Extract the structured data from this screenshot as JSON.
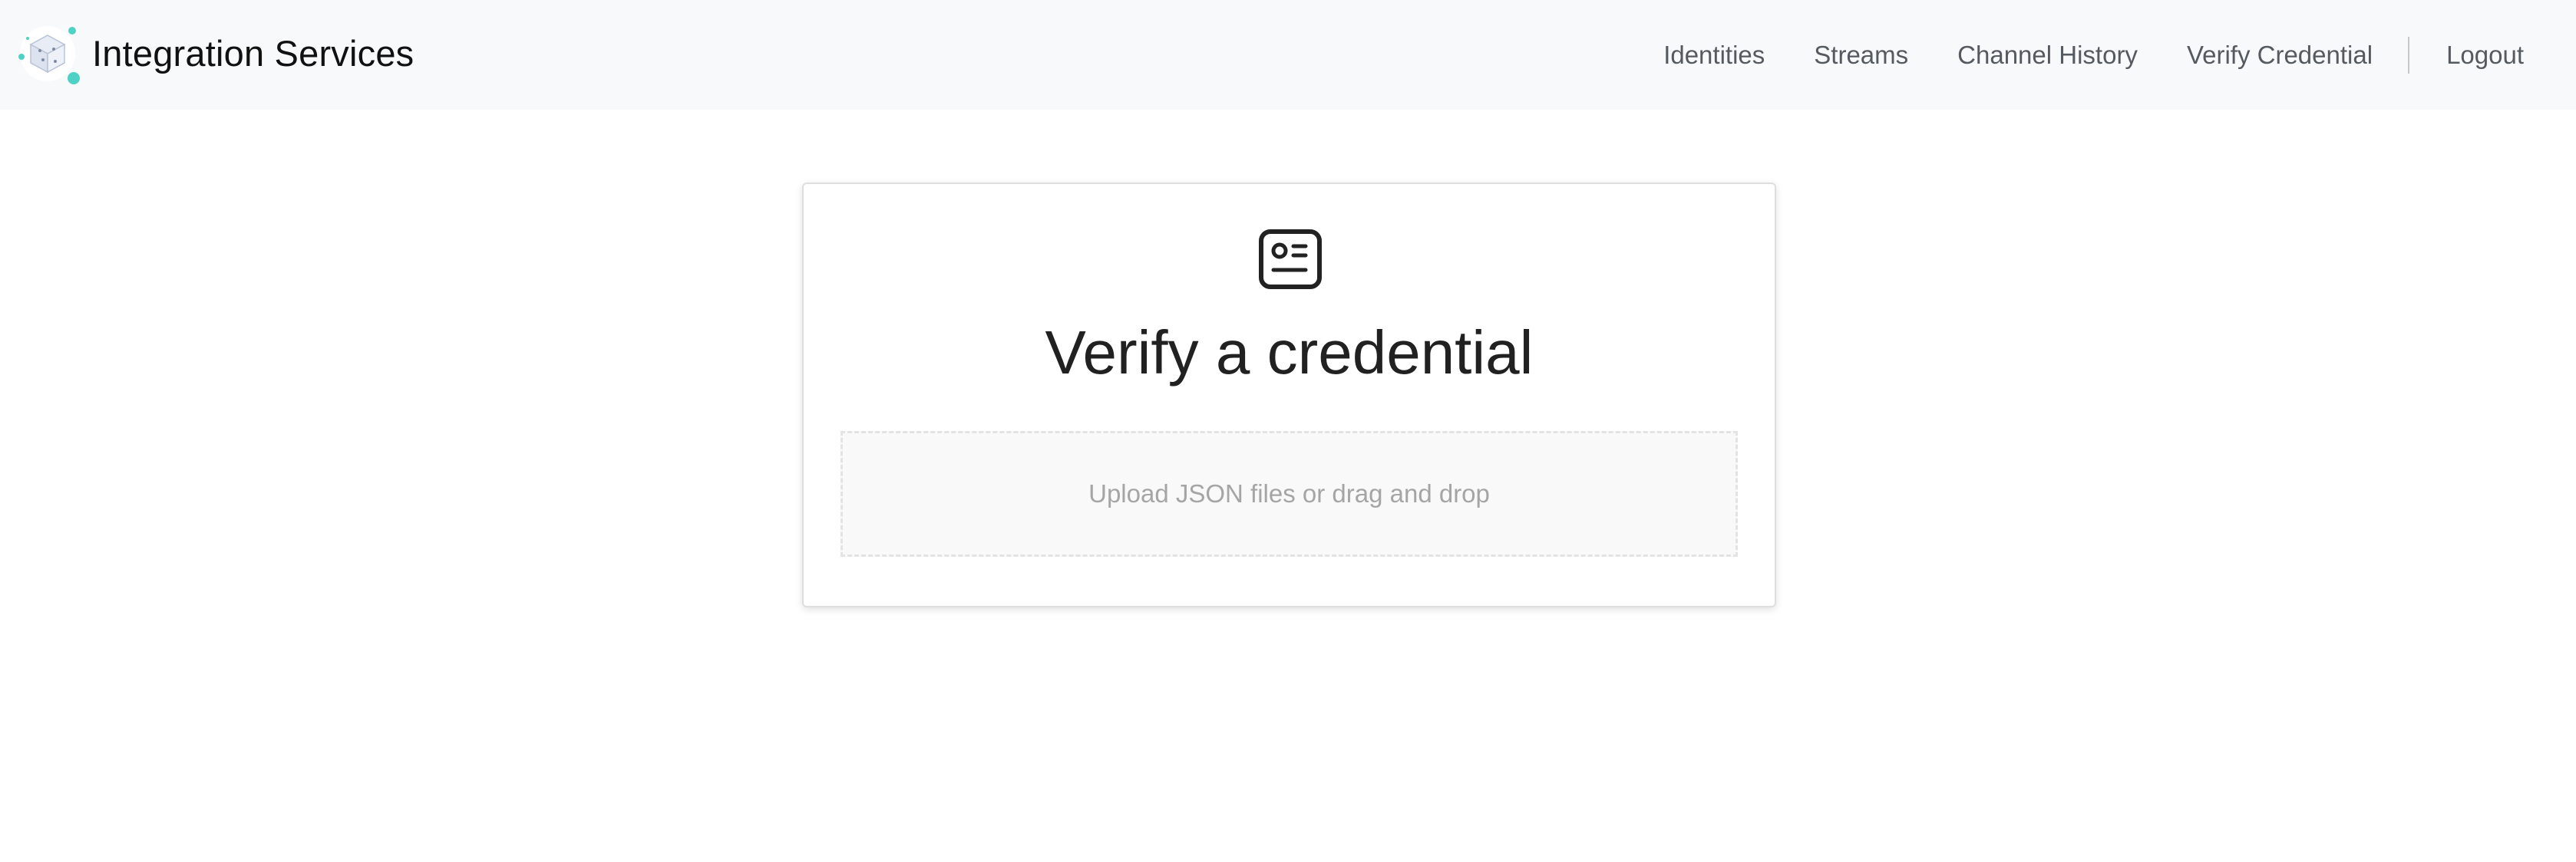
{
  "brand": {
    "name": "Integration Services",
    "logo_icon": "iota-cube-logo",
    "accent_color": "#4fd1c5"
  },
  "nav": {
    "items": [
      {
        "label": "Identities"
      },
      {
        "label": "Streams"
      },
      {
        "label": "Channel History"
      },
      {
        "label": "Verify Credential"
      }
    ],
    "logout_label": "Logout"
  },
  "main": {
    "card_icon": "id-card-icon",
    "title": "Verify a credential",
    "dropzone": {
      "text": "Upload JSON files or drag and drop"
    }
  }
}
